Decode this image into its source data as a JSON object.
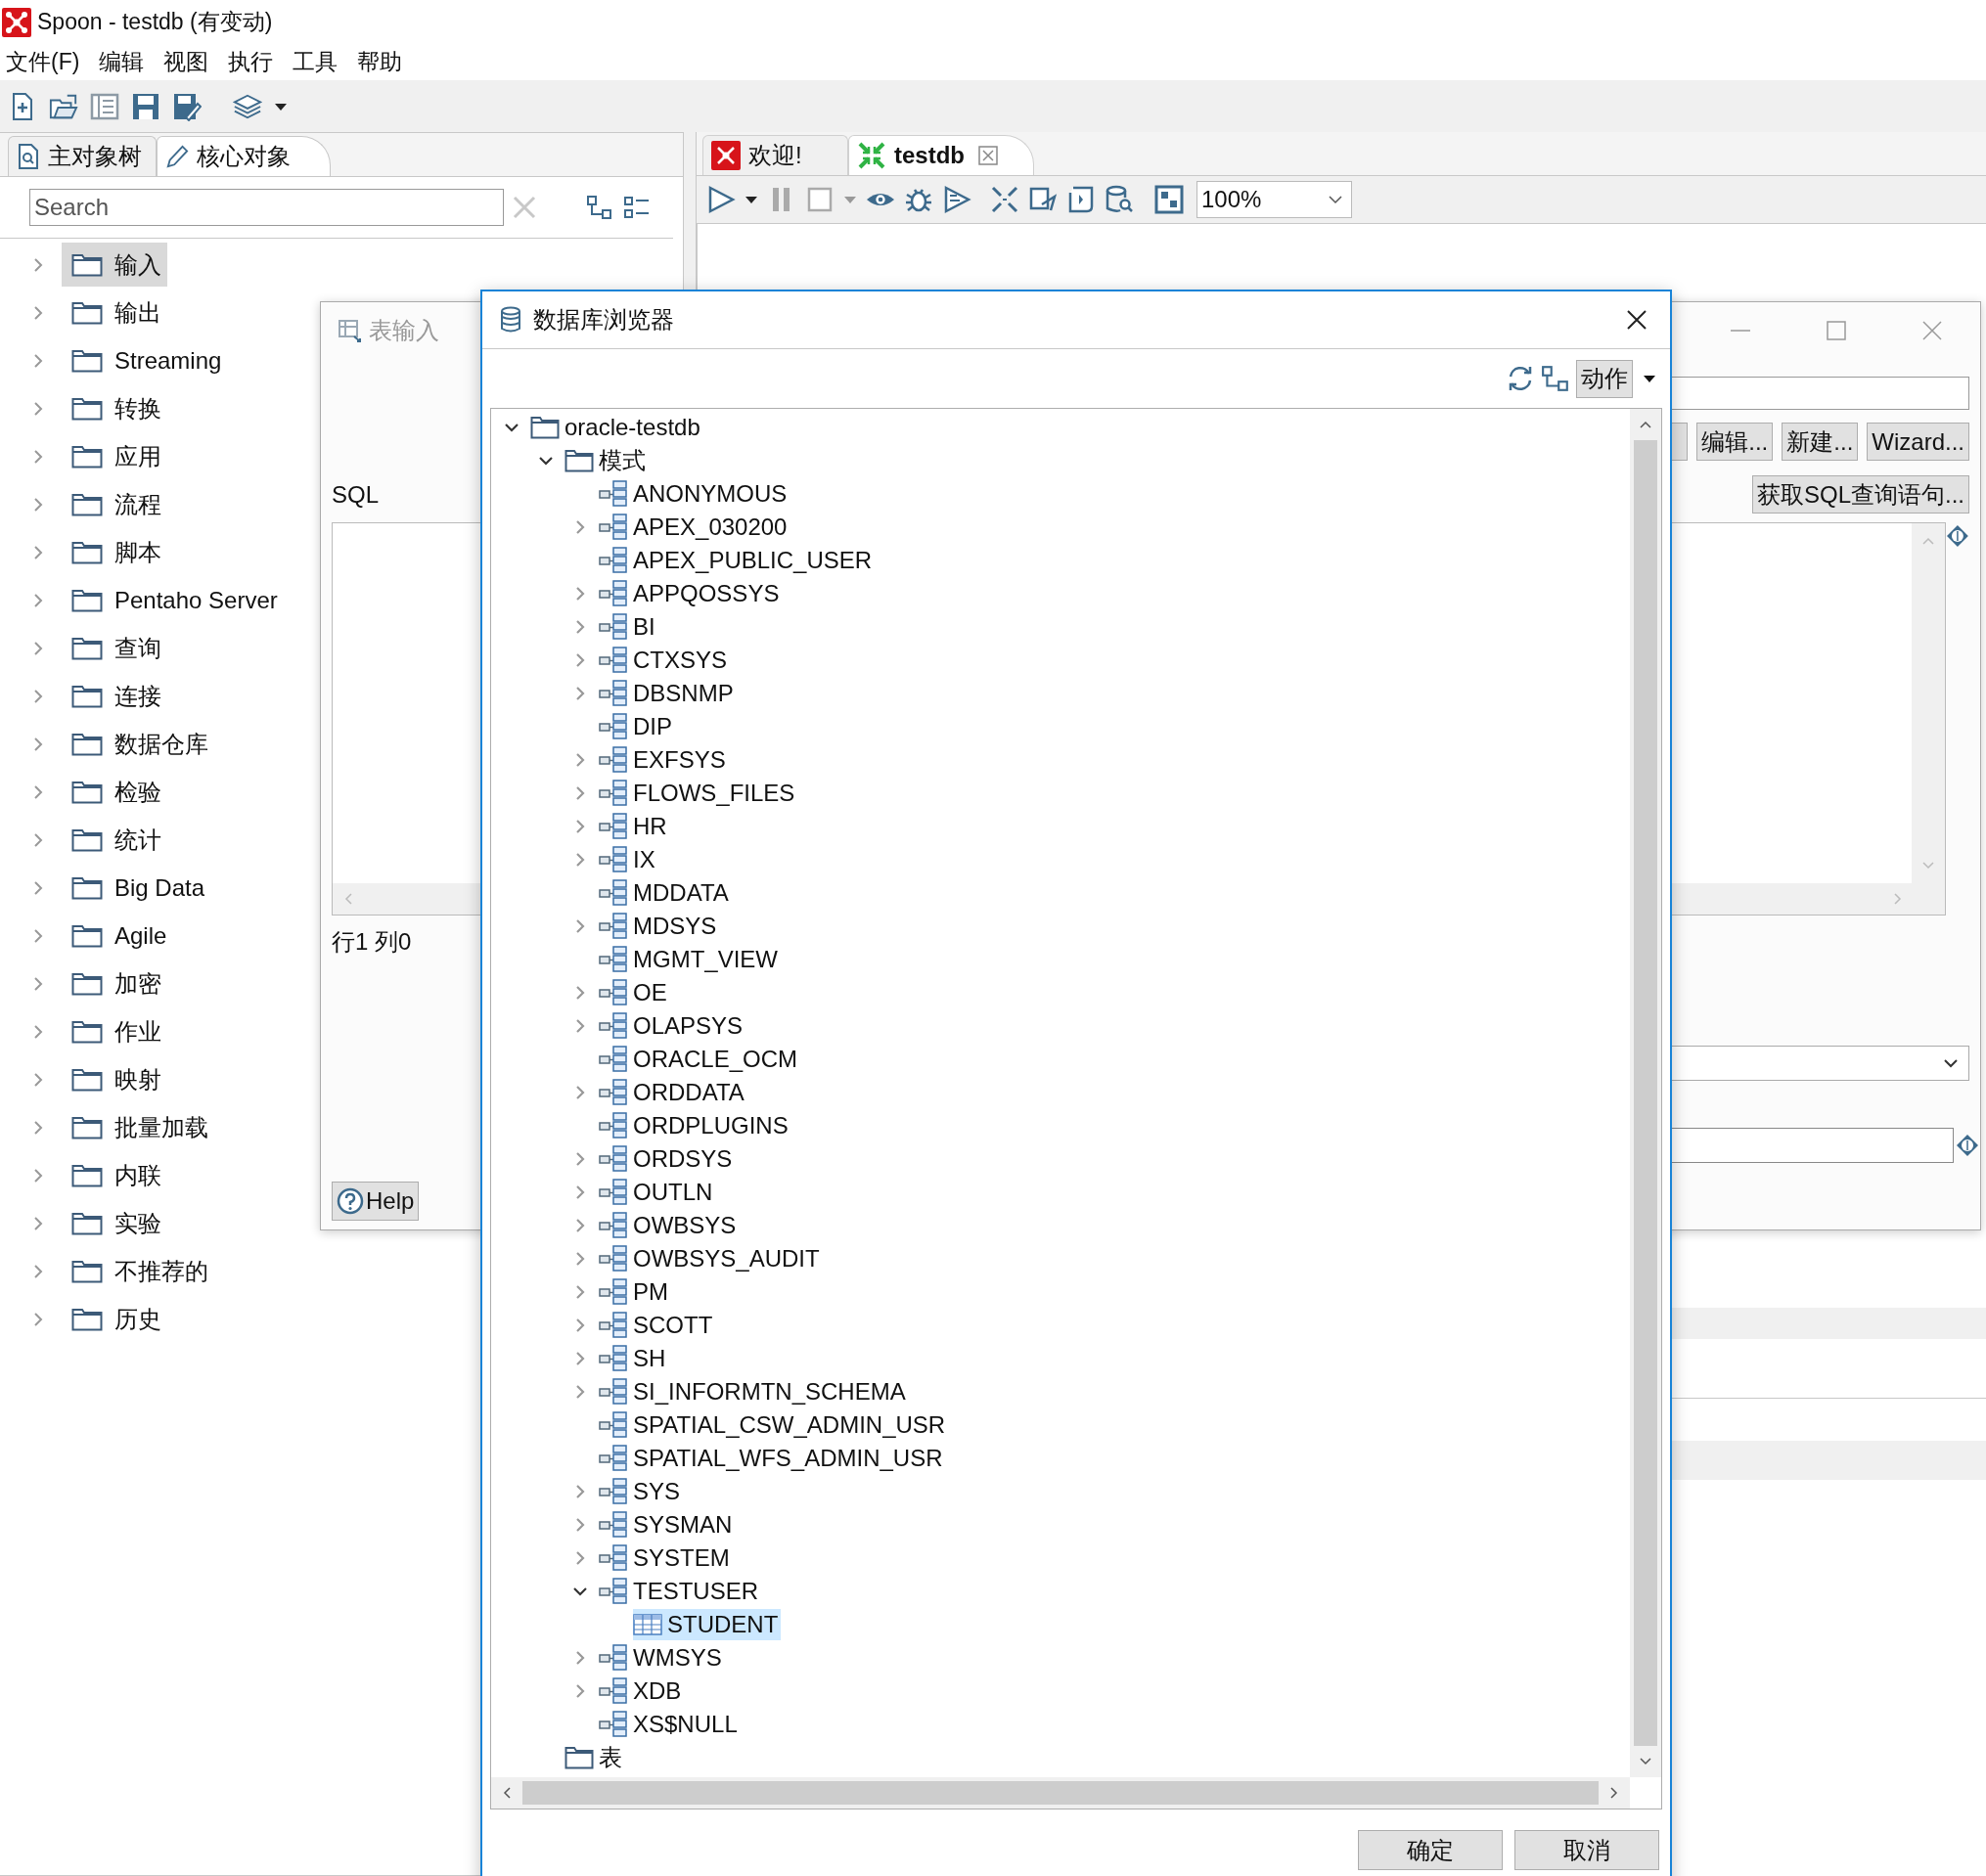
{
  "window": {
    "title": "Spoon - testdb (有变动)"
  },
  "menu": [
    "文件(F)",
    "编辑",
    "视图",
    "执行",
    "工具",
    "帮助"
  ],
  "left_panel": {
    "tabs": [
      {
        "label": "主对象树",
        "selected": false
      },
      {
        "label": "核心对象",
        "selected": true
      }
    ],
    "search": {
      "placeholder": "Search"
    },
    "tree": [
      {
        "label": "输入",
        "selected": true
      },
      {
        "label": "输出",
        "selected": false
      },
      {
        "label": "Streaming",
        "selected": false
      },
      {
        "label": "转换",
        "selected": false
      },
      {
        "label": "应用",
        "selected": false
      },
      {
        "label": "流程",
        "selected": false
      },
      {
        "label": "脚本",
        "selected": false
      },
      {
        "label": "Pentaho Server",
        "selected": false
      },
      {
        "label": "查询",
        "selected": false
      },
      {
        "label": "连接",
        "selected": false
      },
      {
        "label": "数据仓库",
        "selected": false
      },
      {
        "label": "检验",
        "selected": false
      },
      {
        "label": "统计",
        "selected": false
      },
      {
        "label": "Big Data",
        "selected": false
      },
      {
        "label": "Agile",
        "selected": false
      },
      {
        "label": "加密",
        "selected": false
      },
      {
        "label": "作业",
        "selected": false
      },
      {
        "label": "映射",
        "selected": false
      },
      {
        "label": "批量加载",
        "selected": false
      },
      {
        "label": "内联",
        "selected": false
      },
      {
        "label": "实验",
        "selected": false
      },
      {
        "label": "不推荐的",
        "selected": false
      },
      {
        "label": "历史",
        "selected": false
      }
    ]
  },
  "editor": {
    "tabs": [
      {
        "label": "欢迎!",
        "selected": false,
        "closable": false
      },
      {
        "label": "testdb",
        "selected": true,
        "closable": true
      }
    ],
    "zoom": {
      "value": "100%"
    }
  },
  "step_dialog": {
    "title": "表输入",
    "buttons": [
      "编辑...",
      "新建...",
      "Wizard..."
    ],
    "get_sql_button": "获取SQL查询语句...",
    "sql_label": "SQL",
    "cursor_position": "行1 列0",
    "help_button": "Help"
  },
  "browser_dialog": {
    "title": "数据库浏览器",
    "action_button": "动作",
    "tree": [
      {
        "label": "oracle-testdb",
        "kind": "folder",
        "expanded": true,
        "selected": false,
        "children": [
          {
            "label": "模式",
            "kind": "folder",
            "expanded": true,
            "selected": false,
            "children": [
              {
                "label": "ANONYMOUS",
                "kind": "schema",
                "selected": false
              },
              {
                "label": "APEX_030200",
                "kind": "schema",
                "expanded": false,
                "selected": false
              },
              {
                "label": "APEX_PUBLIC_USER",
                "kind": "schema",
                "selected": false
              },
              {
                "label": "APPQOSSYS",
                "kind": "schema",
                "expanded": false,
                "selected": false
              },
              {
                "label": "BI",
                "kind": "schema",
                "expanded": false,
                "selected": false
              },
              {
                "label": "CTXSYS",
                "kind": "schema",
                "expanded": false,
                "selected": false
              },
              {
                "label": "DBSNMP",
                "kind": "schema",
                "expanded": false,
                "selected": false
              },
              {
                "label": "DIP",
                "kind": "schema",
                "selected": false
              },
              {
                "label": "EXFSYS",
                "kind": "schema",
                "expanded": false,
                "selected": false
              },
              {
                "label": "FLOWS_FILES",
                "kind": "schema",
                "expanded": false,
                "selected": false
              },
              {
                "label": "HR",
                "kind": "schema",
                "expanded": false,
                "selected": false
              },
              {
                "label": "IX",
                "kind": "schema",
                "expanded": false,
                "selected": false
              },
              {
                "label": "MDDATA",
                "kind": "schema",
                "selected": false
              },
              {
                "label": "MDSYS",
                "kind": "schema",
                "expanded": false,
                "selected": false
              },
              {
                "label": "MGMT_VIEW",
                "kind": "schema",
                "selected": false
              },
              {
                "label": "OE",
                "kind": "schema",
                "expanded": false,
                "selected": false
              },
              {
                "label": "OLAPSYS",
                "kind": "schema",
                "expanded": false,
                "selected": false
              },
              {
                "label": "ORACLE_OCM",
                "kind": "schema",
                "selected": false
              },
              {
                "label": "ORDDATA",
                "kind": "schema",
                "expanded": false,
                "selected": false
              },
              {
                "label": "ORDPLUGINS",
                "kind": "schema",
                "selected": false
              },
              {
                "label": "ORDSYS",
                "kind": "schema",
                "expanded": false,
                "selected": false
              },
              {
                "label": "OUTLN",
                "kind": "schema",
                "expanded": false,
                "selected": false
              },
              {
                "label": "OWBSYS",
                "kind": "schema",
                "expanded": false,
                "selected": false
              },
              {
                "label": "OWBSYS_AUDIT",
                "kind": "schema",
                "expanded": false,
                "selected": false
              },
              {
                "label": "PM",
                "kind": "schema",
                "expanded": false,
                "selected": false
              },
              {
                "label": "SCOTT",
                "kind": "schema",
                "expanded": false,
                "selected": false
              },
              {
                "label": "SH",
                "kind": "schema",
                "expanded": false,
                "selected": false
              },
              {
                "label": "SI_INFORMTN_SCHEMA",
                "kind": "schema",
                "expanded": false,
                "selected": false
              },
              {
                "label": "SPATIAL_CSW_ADMIN_USR",
                "kind": "schema",
                "selected": false
              },
              {
                "label": "SPATIAL_WFS_ADMIN_USR",
                "kind": "schema",
                "selected": false
              },
              {
                "label": "SYS",
                "kind": "schema",
                "expanded": false,
                "selected": false
              },
              {
                "label": "SYSMAN",
                "kind": "schema",
                "expanded": false,
                "selected": false
              },
              {
                "label": "SYSTEM",
                "kind": "schema",
                "expanded": false,
                "selected": false
              },
              {
                "label": "TESTUSER",
                "kind": "schema",
                "expanded": true,
                "selected": false,
                "children": [
                  {
                    "label": "STUDENT",
                    "kind": "table",
                    "selected": true
                  }
                ]
              },
              {
                "label": "WMSYS",
                "kind": "schema",
                "expanded": false,
                "selected": false
              },
              {
                "label": "XDB",
                "kind": "schema",
                "expanded": false,
                "selected": false
              },
              {
                "label": "XS$NULL",
                "kind": "schema",
                "selected": false
              }
            ]
          },
          {
            "label": "表",
            "kind": "folder",
            "selected": false
          }
        ]
      }
    ],
    "buttons": [
      "确定",
      "取消"
    ]
  }
}
